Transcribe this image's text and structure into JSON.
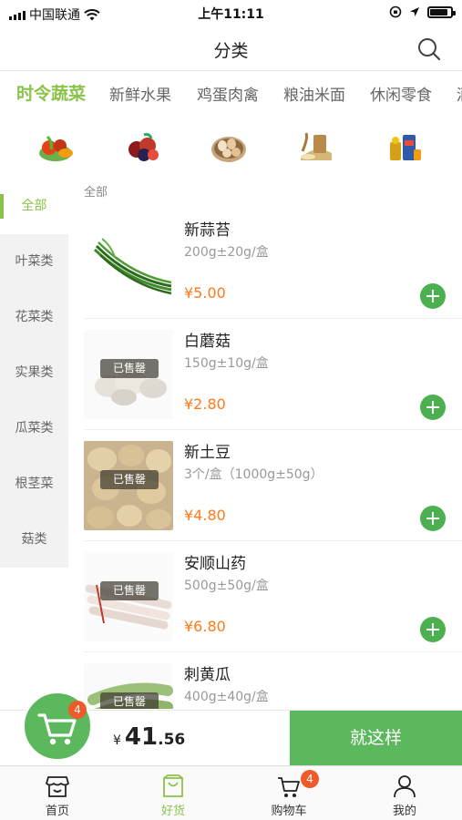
{
  "status": {
    "carrier": "中国联通",
    "time": "上午11:11"
  },
  "navbar": {
    "title": "分类"
  },
  "categories": [
    {
      "label": "时令蔬菜",
      "active": true
    },
    {
      "label": "新鲜水果",
      "active": false
    },
    {
      "label": "鸡蛋肉禽",
      "active": false
    },
    {
      "label": "粮油米面",
      "active": false
    },
    {
      "label": "休闲零食",
      "active": false
    },
    {
      "label": "酒",
      "active": false
    }
  ],
  "sidebar": {
    "items": [
      {
        "label": "全部",
        "active": true
      },
      {
        "label": "叶菜类",
        "active": false
      },
      {
        "label": "花菜类",
        "active": false
      },
      {
        "label": "实果类",
        "active": false
      },
      {
        "label": "瓜菜类",
        "active": false
      },
      {
        "label": "根茎菜",
        "active": false
      },
      {
        "label": "菇类",
        "active": false
      }
    ]
  },
  "list": {
    "header": "全部",
    "products": [
      {
        "name": "新蒜苔",
        "spec": "200g±20g/盒",
        "price": "¥5.00",
        "sold_out": ""
      },
      {
        "name": "白蘑菇",
        "spec": "150g±10g/盒",
        "price": "¥2.80",
        "sold_out": "已售罄"
      },
      {
        "name": "新土豆",
        "spec": "3个/盒（1000g±50g）",
        "price": "¥4.80",
        "sold_out": "已售罄"
      },
      {
        "name": "安顺山药",
        "spec": "500g±50g/盒",
        "price": "¥6.80",
        "sold_out": "已售罄"
      },
      {
        "name": "刺黄瓜",
        "spec": "400g±40g/盒",
        "price": "",
        "sold_out": "已售罄"
      }
    ]
  },
  "cart": {
    "badge": "4",
    "currency": "¥",
    "total_int": "41",
    "total_dec": ".56",
    "checkout_label": "就这样"
  },
  "tabbar": {
    "items": [
      {
        "label": "首页",
        "active": false,
        "badge": ""
      },
      {
        "label": "好货",
        "active": true,
        "badge": ""
      },
      {
        "label": "购物车",
        "active": false,
        "badge": "4"
      },
      {
        "label": "我的",
        "active": false,
        "badge": ""
      }
    ]
  },
  "colors": {
    "accent": "#8bc34a",
    "green_button": "#5cb85c",
    "price": "#ff7a1a",
    "badge": "#f05a28"
  }
}
